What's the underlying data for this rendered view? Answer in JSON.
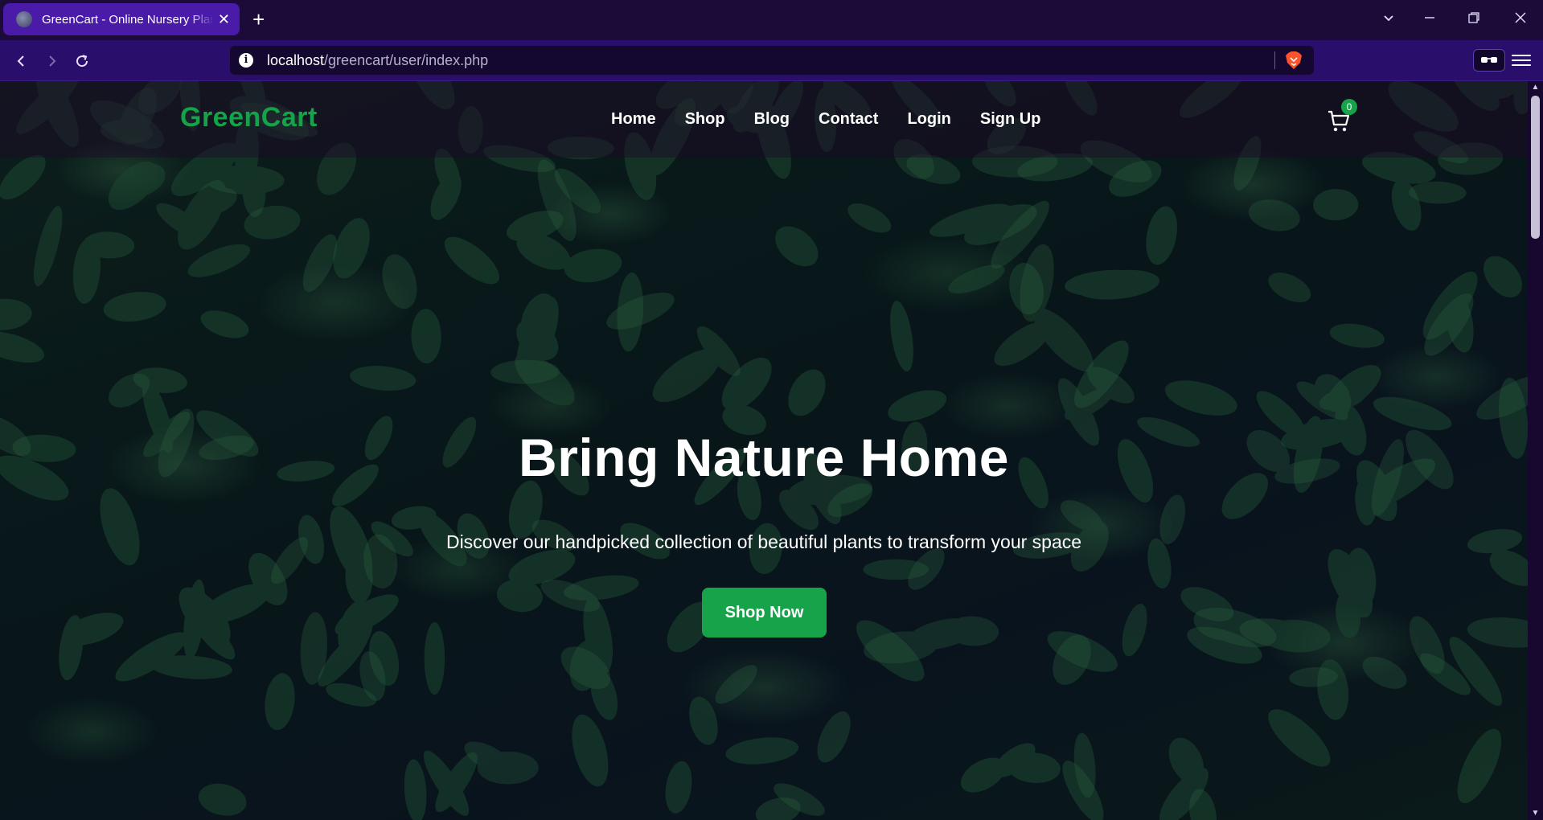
{
  "browser": {
    "tab_title": "GreenCart - Online Nursery Plant Shop",
    "new_tab_symbol": "+",
    "close_tab_symbol": "✕",
    "url_host": "localhost",
    "url_path": "/greencart/user/index.php",
    "accent_color": "#4a1aa8"
  },
  "site": {
    "logo": "GreenCart",
    "brand_color": "#16a34a",
    "nav": [
      "Home",
      "Shop",
      "Blog",
      "Contact",
      "Login",
      "Sign Up"
    ],
    "cart_count": "0"
  },
  "hero": {
    "title": "Bring Nature Home",
    "subtitle": "Discover our handpicked collection of beautiful plants to transform your space",
    "cta_label": "Shop Now"
  },
  "icons": {
    "tab_favicon": "globe-icon",
    "back": "back-arrow-icon",
    "forward": "forward-arrow-icon",
    "reload": "reload-icon",
    "site_info": "info-icon",
    "shields": "brave-lion-icon",
    "reader": "reader-mode-icon",
    "menu": "hamburger-menu-icon",
    "cart": "cart-icon"
  }
}
